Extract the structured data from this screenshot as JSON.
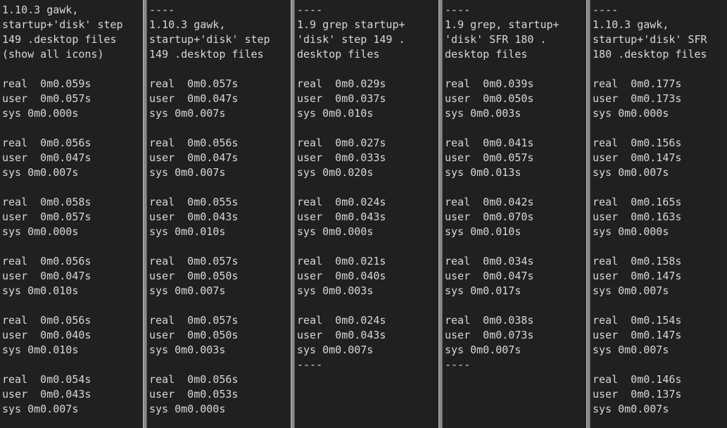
{
  "panes": [
    {
      "lines": [
        "1.10.3 gawk,",
        "startup+'disk' step",
        "149 .desktop files",
        "(show all icons)",
        "",
        "real  0m0.059s",
        "user  0m0.057s",
        "sys 0m0.000s",
        "",
        "real  0m0.056s",
        "user  0m0.047s",
        "sys 0m0.007s",
        "",
        "real  0m0.058s",
        "user  0m0.057s",
        "sys 0m0.000s",
        "",
        "real  0m0.056s",
        "user  0m0.047s",
        "sys 0m0.010s",
        "",
        "real  0m0.056s",
        "user  0m0.040s",
        "sys 0m0.010s",
        "",
        "real  0m0.054s",
        "user  0m0.043s",
        "sys 0m0.007s"
      ]
    },
    {
      "lines": [
        "----",
        "1.10.3 gawk,",
        "startup+'disk' step",
        "149 .desktop files",
        "",
        "real  0m0.057s",
        "user  0m0.047s",
        "sys 0m0.007s",
        "",
        "real  0m0.056s",
        "user  0m0.047s",
        "sys 0m0.007s",
        "",
        "real  0m0.055s",
        "user  0m0.043s",
        "sys 0m0.010s",
        "",
        "real  0m0.057s",
        "user  0m0.050s",
        "sys 0m0.007s",
        "",
        "real  0m0.057s",
        "user  0m0.050s",
        "sys 0m0.003s",
        "",
        "real  0m0.056s",
        "user  0m0.053s",
        "sys 0m0.000s"
      ]
    },
    {
      "lines": [
        "----",
        "1.9 grep startup+",
        "'disk' step 149 .",
        "desktop files",
        "",
        "real  0m0.029s",
        "user  0m0.037s",
        "sys 0m0.010s",
        "",
        "real  0m0.027s",
        "user  0m0.033s",
        "sys 0m0.020s",
        "",
        "real  0m0.024s",
        "user  0m0.043s",
        "sys 0m0.000s",
        "",
        "real  0m0.021s",
        "user  0m0.040s",
        "sys 0m0.003s",
        "",
        "real  0m0.024s",
        "user  0m0.043s",
        "sys 0m0.007s",
        "----"
      ]
    },
    {
      "lines": [
        "----",
        "1.9 grep, startup+",
        "'disk' SFR 180 .",
        "desktop files",
        "",
        "real  0m0.039s",
        "user  0m0.050s",
        "sys 0m0.003s",
        "",
        "real  0m0.041s",
        "user  0m0.057s",
        "sys 0m0.013s",
        "",
        "real  0m0.042s",
        "user  0m0.070s",
        "sys 0m0.010s",
        "",
        "real  0m0.034s",
        "user  0m0.047s",
        "sys 0m0.017s",
        "",
        "real  0m0.038s",
        "user  0m0.073s",
        "sys 0m0.007s",
        "----"
      ]
    },
    {
      "lines": [
        "----",
        "1.10.3 gawk,",
        "startup+'disk' SFR",
        "180 .desktop files",
        "",
        "real  0m0.177s",
        "user  0m0.173s",
        "sys 0m0.000s",
        "",
        "real  0m0.156s",
        "user  0m0.147s",
        "sys 0m0.007s",
        "",
        "real  0m0.165s",
        "user  0m0.163s",
        "sys 0m0.000s",
        "",
        "real  0m0.158s",
        "user  0m0.147s",
        "sys 0m0.007s",
        "",
        "real  0m0.154s",
        "user  0m0.147s",
        "sys 0m0.007s",
        "",
        "real  0m0.146s",
        "user  0m0.137s",
        "sys 0m0.007s"
      ]
    }
  ]
}
